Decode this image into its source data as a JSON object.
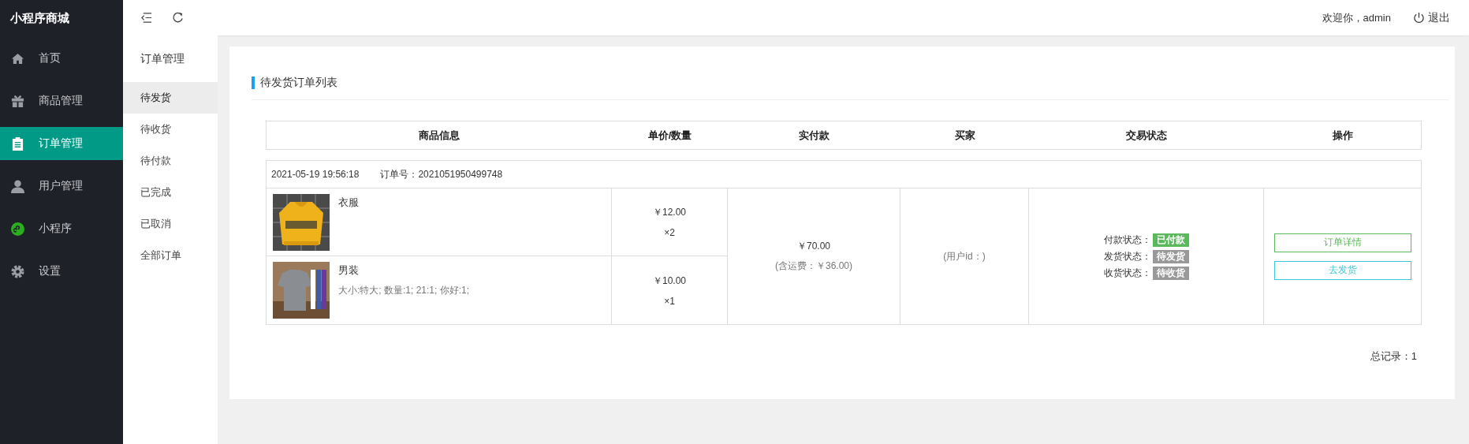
{
  "app_title": "小程序商城",
  "nav": [
    {
      "label": "首页",
      "kind": "home",
      "selected": false
    },
    {
      "label": "商品管理",
      "kind": "gift",
      "selected": false
    },
    {
      "label": "订单管理",
      "kind": "clipboard",
      "selected": true
    },
    {
      "label": "用户管理",
      "kind": "user",
      "selected": false
    },
    {
      "label": "小程序",
      "kind": "miniapp",
      "selected": false
    },
    {
      "label": "设置",
      "kind": "gear",
      "selected": false
    }
  ],
  "header": {
    "welcome": "欢迎你，admin",
    "logout": "退出"
  },
  "submenu": {
    "title": "订单管理",
    "items": [
      {
        "label": "待发货",
        "selected": true
      },
      {
        "label": "待收货",
        "selected": false
      },
      {
        "label": "待付款",
        "selected": false
      },
      {
        "label": "已完成",
        "selected": false
      },
      {
        "label": "已取消",
        "selected": false
      },
      {
        "label": "全部订单",
        "selected": false
      }
    ]
  },
  "panel": {
    "title": "待发货订单列表"
  },
  "table": {
    "columns": [
      "商品信息",
      "单价/数量",
      "实付款",
      "买家",
      "交易状态",
      "操作"
    ],
    "orders": [
      {
        "time": "2021-05-19 19:56:18",
        "order_no": "订单号：2021051950499748",
        "items": [
          {
            "name": "衣服",
            "price": "￥12.00",
            "qty": "×2"
          },
          {
            "name": "男装",
            "specs": "大小:特大; 数量:1; 21:1; 你好:1;",
            "price": "￥10.00",
            "qty": "×1"
          }
        ],
        "total": "￥70.00",
        "shipping": "(含运费：￥36.00)",
        "buyer": "(用户id：)",
        "statuses": [
          {
            "label": "付款状态：",
            "value": "已付款",
            "color": "#5cb85c"
          },
          {
            "label": "发货状态：",
            "value": "待发货",
            "color": "#999999"
          },
          {
            "label": "收货状态：",
            "value": "待收货",
            "color": "#999999"
          }
        ],
        "actions": [
          {
            "label": "订单详情",
            "color": "#5cb85c"
          },
          {
            "label": "去发货",
            "color": "#3ec6d4"
          }
        ]
      }
    ]
  },
  "total_records": "总记录：1"
}
